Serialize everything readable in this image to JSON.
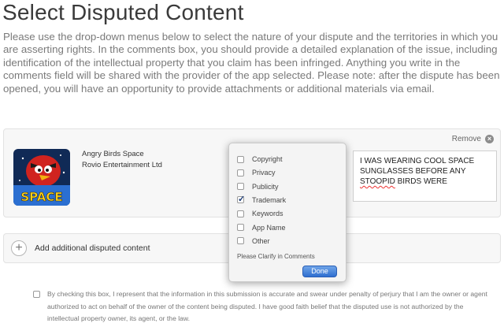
{
  "page": {
    "title": "Select Disputed Content",
    "intro": "Please use the drop-down menus below to select the nature of your dispute and the territories in which you are asserting rights. In the comments box, you should provide a detailed explanation of the issue, including identification of the intellectual property that you claim has been infringed. Anything you write in the comments field will be shared with the provider of the app selected. Please note: after the dispute has been opened, you will have an opportunity to provide attachments or additional materials via email."
  },
  "item": {
    "remove_label": "Remove",
    "app_name": "Angry Birds Space",
    "developer": "Rovio Entertainment Ltd",
    "icon_text": "SPACE",
    "comments": {
      "line1": "I WAS WEARING COOL SPACE",
      "line2": "SUNGLASSES BEFORE ANY",
      "word_flagged": "STOOPID",
      "line3_rest": " BIRDS WERE"
    }
  },
  "dispute_types": [
    {
      "label": "Copyright",
      "checked": false
    },
    {
      "label": "Privacy",
      "checked": false
    },
    {
      "label": "Publicity",
      "checked": false
    },
    {
      "label": "Trademark",
      "checked": true
    },
    {
      "label": "Keywords",
      "checked": false
    },
    {
      "label": "App Name",
      "checked": false
    },
    {
      "label": "Other",
      "checked": false
    }
  ],
  "dropdown": {
    "clarify_note": "Please Clarify in Comments",
    "done_label": "Done"
  },
  "add_content": {
    "label": "Add additional disputed content"
  },
  "terms": {
    "checked": false,
    "text": "By checking this box, I represent that the information in this submission is accurate and swear under penalty of perjury that I am the owner or agent authorized to act on behalf of the owner of the content being disputed. I have good faith belief that the disputed use is not authorized by the intellectual property owner, its agent, or the law."
  },
  "colors": {
    "accent": "#2f6fd0",
    "card_bg": "#f7f7f7",
    "intro_text": "#7a7a7a"
  }
}
